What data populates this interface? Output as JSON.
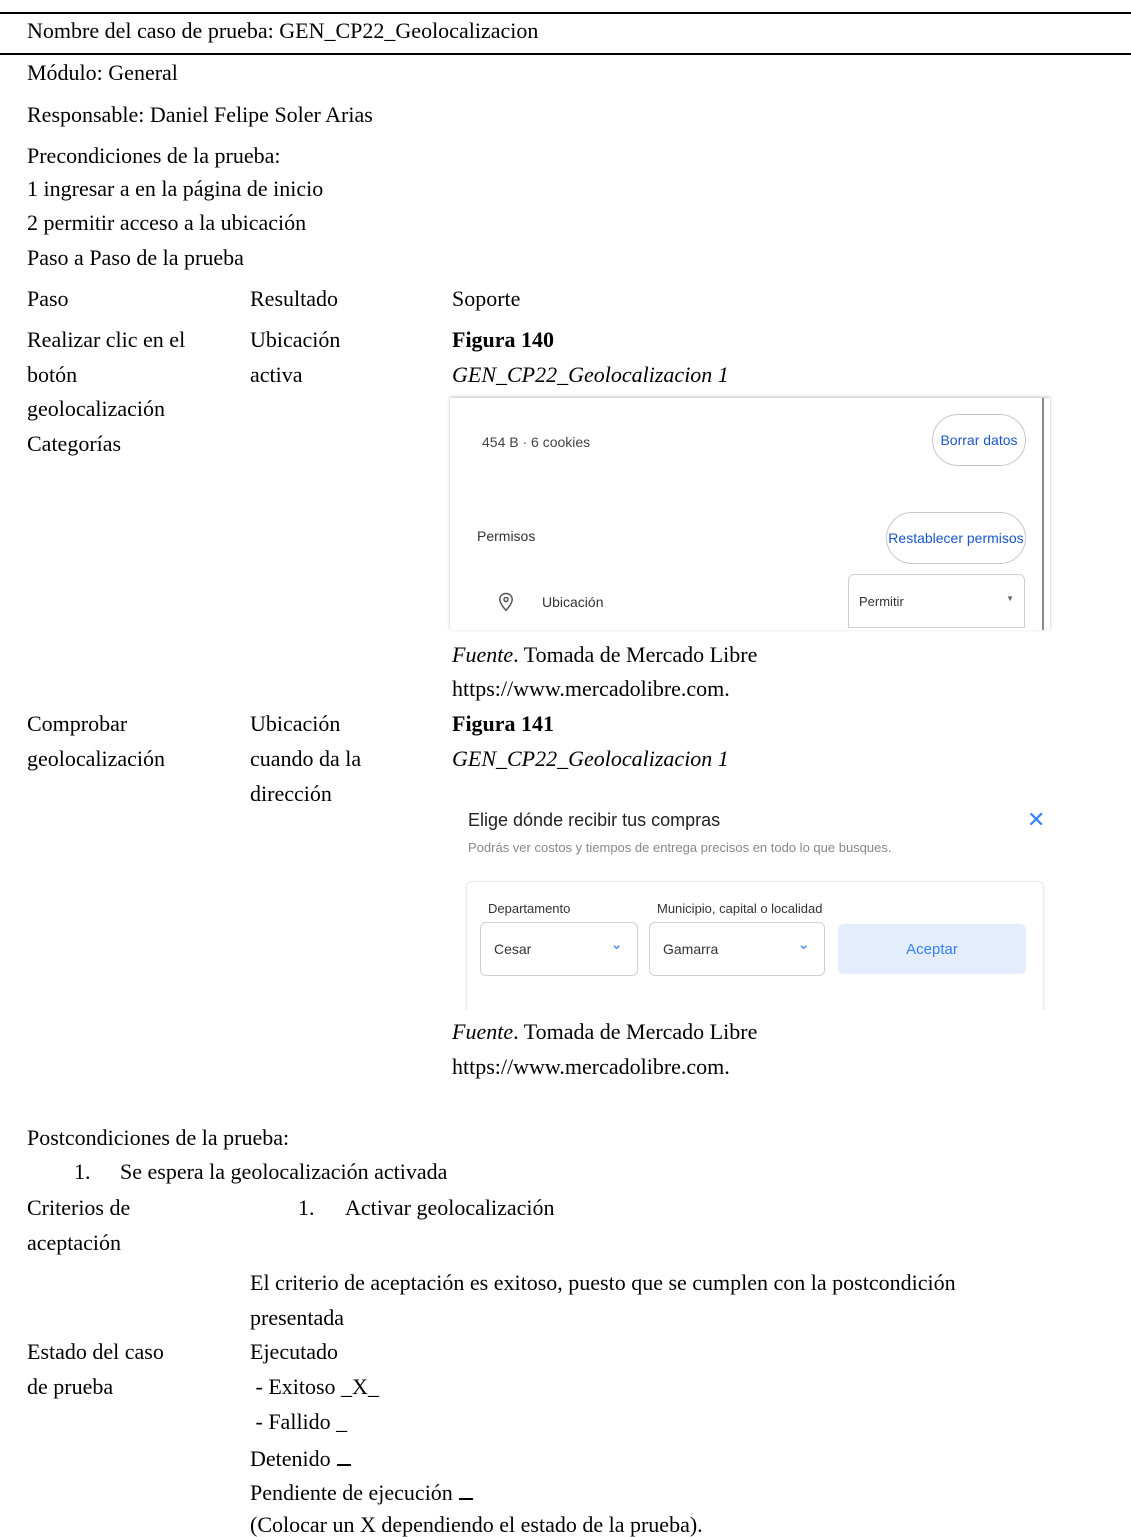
{
  "case_name": "Nombre del caso de prueba: GEN_CP22_Geolocalizacion",
  "module": "Módulo: General",
  "responsible": "Responsable: Daniel Felipe Soler Arias",
  "preconditions": {
    "heading": "Precondiciones de la prueba:",
    "items": [
      "1 ingresar a en la página de inicio",
      "2 permitir acceso a la ubicación"
    ]
  },
  "steps_heading": "Paso a Paso de la prueba",
  "table_headers": {
    "step": "Paso",
    "result": "Resultado",
    "support": "Soporte"
  },
  "rows": [
    {
      "step_lines": [
        "Realizar clic en el",
        "botón",
        "geolocalización",
        "Categorías"
      ],
      "result_lines": [
        "Ubicación",
        "activa"
      ],
      "figure_label": "Figura 140",
      "figure_caption": "GEN_CP22_Geolocalizacion  1",
      "source_prefix": "Fuente",
      "source_text": ". Tomada de Mercado Libre",
      "source_url": "https://www.mercadolibre.com."
    },
    {
      "step_lines": [
        "Comprobar",
        "geolocalización"
      ],
      "result_lines": [
        "Ubicación",
        "cuando da la",
        "dirección"
      ],
      "figure_label": "Figura 141",
      "figure_caption": "GEN_CP22_Geolocalizacion  1",
      "source_prefix": "Fuente",
      "source_text": ". Tomada de Mercado Libre",
      "source_url": "https://www.mercadolibre.com."
    }
  ],
  "shot1": {
    "storage": "454 B · 6 cookies",
    "clear_button": "Borrar datos",
    "permissions_label": "Permisos",
    "reset_button": "Restablecer permisos",
    "location_label": "Ubicación",
    "location_value": "Permitir",
    "location_icon": "location-pin-icon"
  },
  "shot2": {
    "title": "Elige dónde recibir tus compras",
    "subtitle": "Podrás ver costos y tiempos de entrega precisos en todo lo que busques.",
    "department_label": "Departamento",
    "department_value": "Cesar",
    "municipality_label": "Municipio, capital o localidad",
    "municipality_value": "Gamarra",
    "accept_button": "Aceptar",
    "close_icon": "close-icon",
    "accent": "#3483fa"
  },
  "postconditions": {
    "heading": "Postcondiciones de la prueba:",
    "item_number": "1.",
    "item": "Se espera la geolocalización activada"
  },
  "acceptance": {
    "label_lines": [
      "Criterios de",
      "aceptación"
    ],
    "item_number": "1.",
    "item": "Activar geolocalización",
    "text_lines": [
      "El criterio de aceptación es exitoso, puesto que se cumplen con la postcondición",
      "presentada"
    ]
  },
  "status": {
    "label_lines": [
      "Estado del caso",
      "de prueba"
    ],
    "executed": "Ejecutado",
    "success": " - Exitoso _X_",
    "failed": " - Fallido _",
    "stopped": "Detenido",
    "pending": "Pendiente de ejecución",
    "note": "(Colocar un X dependiendo el estado de la prueba)."
  }
}
